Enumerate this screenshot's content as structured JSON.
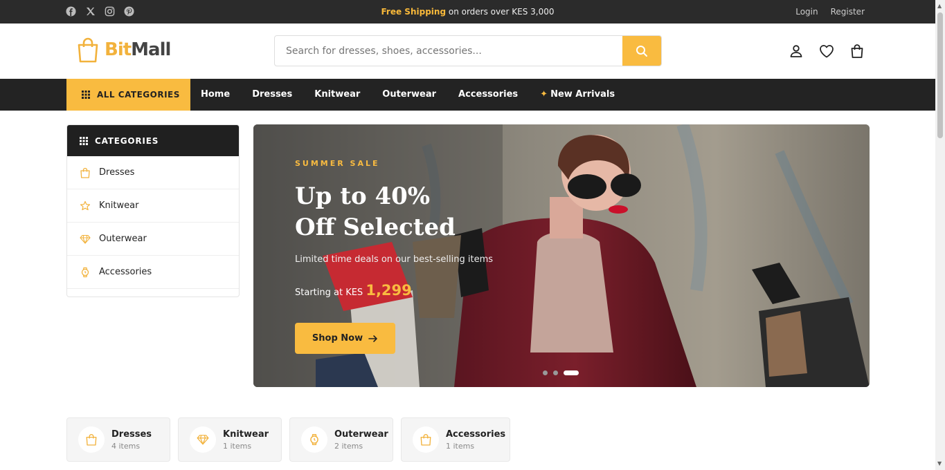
{
  "topbar": {
    "promo_bold": "Free Shipping",
    "promo_rest": "on orders over KES 3,000",
    "login": "Login",
    "register": "Register",
    "social_icons": [
      "facebook-icon",
      "x-icon",
      "instagram-icon",
      "pinterest-icon"
    ]
  },
  "header": {
    "logo_part1": "Bit",
    "logo_part2": "Mall",
    "search_placeholder": "Search for dresses, shoes, accessories...",
    "icons": [
      "user-icon",
      "heart-icon",
      "bag-icon"
    ]
  },
  "nav": {
    "all_categories": "ALL CATEGORIES",
    "links": [
      "Home",
      "Dresses",
      "Knitwear",
      "Outerwear",
      "Accessories",
      "New Arrivals"
    ]
  },
  "sidebar": {
    "title": "CATEGORIES",
    "items": [
      {
        "label": "Dresses",
        "icon": "bag-icon"
      },
      {
        "label": "Knitwear",
        "icon": "star-icon"
      },
      {
        "label": "Outerwear",
        "icon": "diamond-icon"
      },
      {
        "label": "Accessories",
        "icon": "watch-icon"
      }
    ]
  },
  "hero": {
    "tag": "SUMMER SALE",
    "title_line1": "Up to 40%",
    "title_line2": "Off Selected",
    "subtitle": "Limited time deals on our best-selling items",
    "price_prefix": "Starting at KES",
    "price": "1,299",
    "button": "Shop Now",
    "slides": 3,
    "active_slide": 3
  },
  "category_cards": [
    {
      "name": "Dresses",
      "count": "4 items",
      "icon": "bag-icon"
    },
    {
      "name": "Knitwear",
      "count": "1 items",
      "icon": "diamond-icon"
    },
    {
      "name": "Outerwear",
      "count": "2 items",
      "icon": "watch-icon"
    },
    {
      "name": "Accessories",
      "count": "1 items",
      "icon": "bag-icon"
    }
  ],
  "colors": {
    "accent": "#f9bb40",
    "dark": "#232323"
  }
}
